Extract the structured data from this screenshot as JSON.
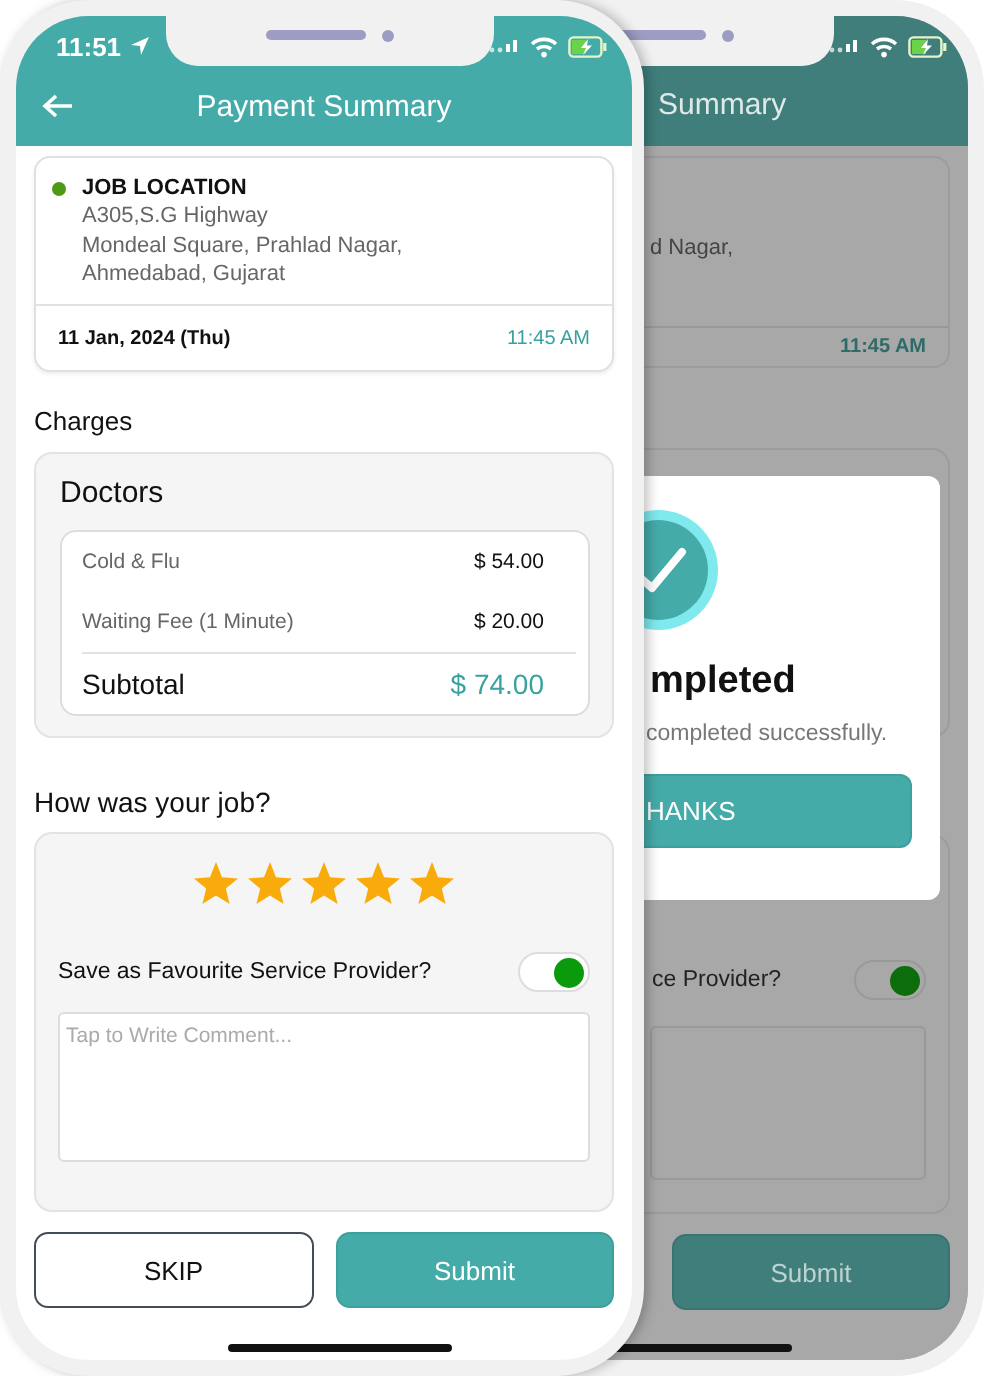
{
  "front_screen": {
    "status_time": "11:51",
    "header": {
      "title": "Payment Summary"
    },
    "job_location": {
      "label": "JOB LOCATION",
      "address_lines": [
        "A305,S.G Highway",
        "Mondeal Square, Prahlad Nagar,",
        "Ahmedabad, Gujarat"
      ],
      "date": "11 Jan, 2024 (Thu)",
      "time": "11:45 AM"
    },
    "charges": {
      "heading": "Charges",
      "category": "Doctors",
      "items": [
        {
          "name": "Cold & Flu",
          "amount": "$ 54.00"
        },
        {
          "name": "Waiting Fee (1 Minute)",
          "amount": "$ 20.00"
        }
      ],
      "subtotal_label": "Subtotal",
      "subtotal": "$ 74.00"
    },
    "rating": {
      "heading": "How was your job?",
      "stars": 5,
      "favourite_label": "Save as Favourite Service Provider?",
      "favourite_on": true,
      "comment": {
        "placeholder": "Tap to Write Comment..."
      }
    },
    "buttons": [
      {
        "label": "SKIP",
        "kind": "outline"
      },
      {
        "label": "Submit",
        "kind": "filled"
      }
    ]
  },
  "back_screen": {
    "header_title": "Summary",
    "address_fragment": "d Nagar,",
    "time": "11:45 AM",
    "modal": {
      "title": "mpleted",
      "message": "completed successfully.",
      "button": "HANKS"
    },
    "favourite_label": "ce Provider?",
    "favourite_on": true,
    "submit": "Submit"
  }
}
